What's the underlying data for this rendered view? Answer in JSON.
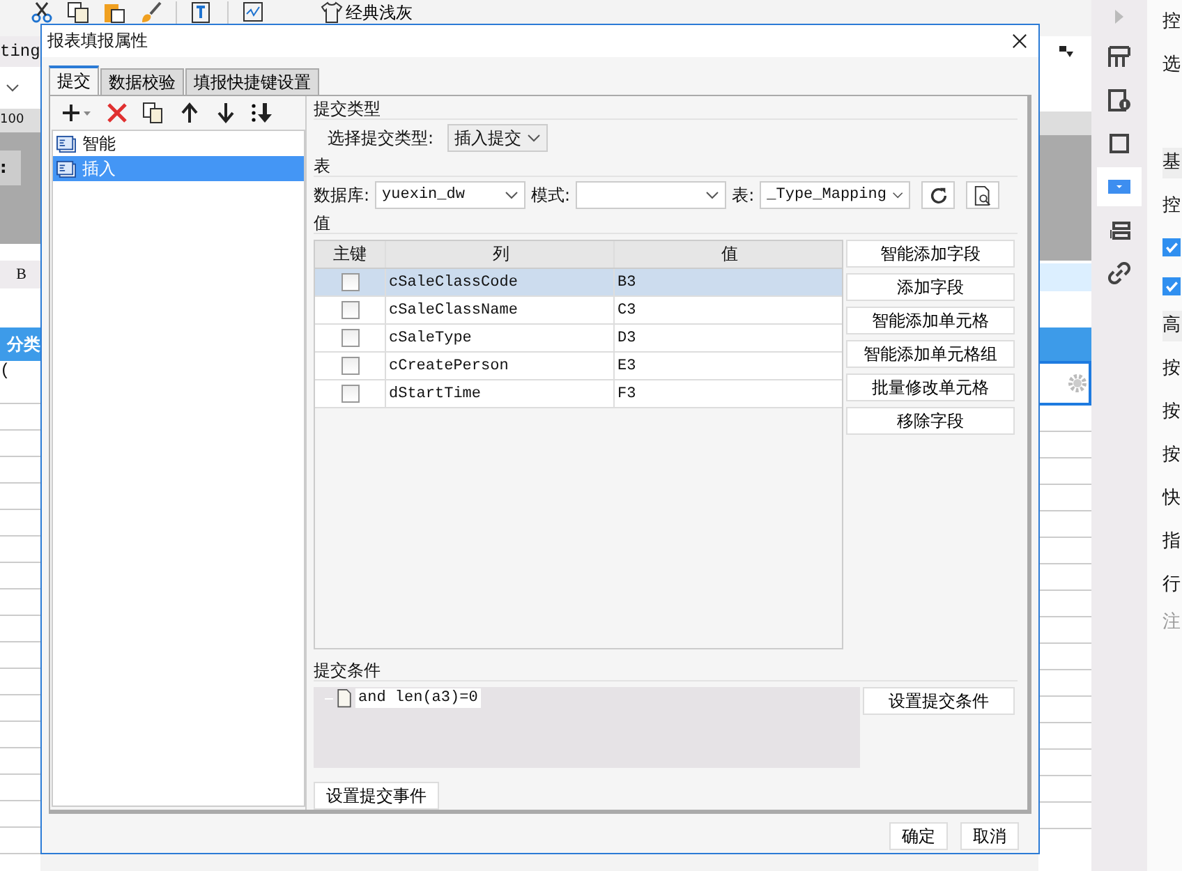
{
  "app": {
    "theme_button": "经典浅灰",
    "name_field": "ting",
    "ruler_label": "100",
    "row_header": ":",
    "column_header": "B",
    "header_cell": "分类",
    "cell_text": "(",
    "panel_items": [
      {
        "kind": "label",
        "text": "控"
      },
      {
        "kind": "label",
        "text": "选"
      },
      {
        "kind": "spacer"
      },
      {
        "kind": "header",
        "text": "基"
      },
      {
        "kind": "label",
        "text": "控"
      },
      {
        "kind": "checkbox",
        "checked": true
      },
      {
        "kind": "checkbox",
        "checked": true
      },
      {
        "kind": "header",
        "text": "高"
      },
      {
        "kind": "label",
        "text": "按"
      },
      {
        "kind": "label",
        "text": "按"
      },
      {
        "kind": "label",
        "text": "按"
      },
      {
        "kind": "label",
        "text": "快"
      },
      {
        "kind": "label",
        "text": "指"
      },
      {
        "kind": "label",
        "text": "行"
      },
      {
        "kind": "note",
        "text": "注"
      }
    ]
  },
  "dialog": {
    "title": "报表填报属性",
    "tabs": [
      {
        "label": "提交",
        "selected": true
      },
      {
        "label": "数据校验",
        "selected": false
      },
      {
        "label": "填报快捷键设置",
        "selected": false
      }
    ],
    "list_items": [
      {
        "label": "智能",
        "selected": false
      },
      {
        "label": "插入",
        "selected": true
      }
    ],
    "submit_type": {
      "heading": "提交类型",
      "label": "选择提交类型:",
      "value": "插入提交"
    },
    "table_section": {
      "heading": "表",
      "database_label": "数据库:",
      "database": "yuexin_dw",
      "schema_label": "模式:",
      "table_label": "表:",
      "table": "_Type_Mapping"
    },
    "values": {
      "heading": "值",
      "columns": [
        "主键",
        "列",
        "值"
      ],
      "rows": [
        {
          "key": false,
          "column": "cSaleClassCode",
          "value": "B3",
          "selected": true
        },
        {
          "key": false,
          "column": "cSaleClassName",
          "value": "C3",
          "selected": false
        },
        {
          "key": false,
          "column": "cSaleType",
          "value": "D3",
          "selected": false
        },
        {
          "key": false,
          "column": "cCreatePerson",
          "value": "E3",
          "selected": false
        },
        {
          "key": false,
          "column": "dStartTime",
          "value": "F3",
          "selected": false
        }
      ],
      "buttons": [
        "智能添加字段",
        "添加字段",
        "智能添加单元格",
        "智能添加单元格组",
        "批量修改单元格",
        "移除字段"
      ]
    },
    "condition": {
      "heading": "提交条件",
      "items": [
        "and len(a3)=0"
      ],
      "button": "设置提交条件"
    },
    "event_button": "设置提交事件",
    "footer_buttons": [
      "确定",
      "取消"
    ]
  }
}
